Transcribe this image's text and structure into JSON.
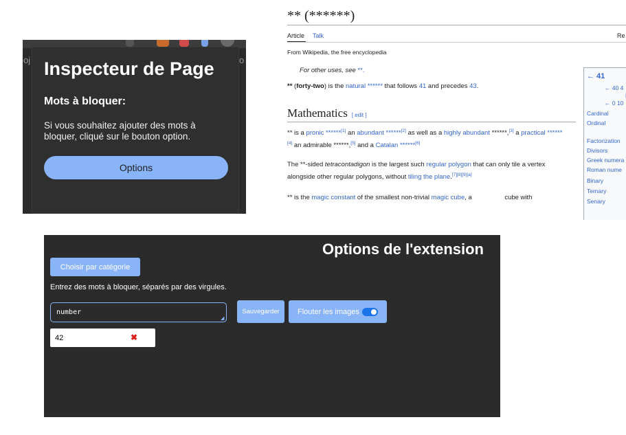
{
  "popup": {
    "side_text_left": "oj",
    "side_text_right": "o",
    "title": "Inspecteur de Page",
    "subtitle": "Mots à bloquer:",
    "info": "Si vous souhaitez ajouter des mots à bloquer, cliqué sur le bouton option.",
    "options_button": "Options",
    "accent_color": "#8ab4f8"
  },
  "wiki": {
    "title": "** (******)",
    "tabs": {
      "article": "Article",
      "talk": "Talk",
      "read": "Re"
    },
    "from": "From Wikipedia, the free encyclopedia",
    "hatnote_prefix": "For other uses, see ",
    "hatnote_link": "**.",
    "intro": {
      "a": "**",
      "b": " (",
      "bold2": "forty-two",
      "c": ") is the ",
      "link1": "natural ******",
      "d": " that follows ",
      "link2": "41",
      "e": " and precedes ",
      "link3": "43",
      "f": "."
    },
    "section_title": "Mathematics",
    "section_edit": "[ edit ]",
    "math_p1": {
      "a": "** is a ",
      "l1": "pronic ******",
      "s1": "[1]",
      "b": " an ",
      "l2": "abundant ******",
      "s2": "[2]",
      "c": " as well as a ",
      "l3": "highly abundant",
      "d": " ******,",
      "s3": "[3]",
      "e": " a ",
      "l4": "practical ******",
      "s4": "[4]",
      "f": " an admirable ******,",
      "s5": "[5]",
      "g": " and a ",
      "l5": "Catalan ******",
      "s6": "[6]"
    },
    "math_p2": {
      "a": "The **-sided ",
      "i": "tetracontadigon",
      "b": " is the largest such ",
      "l1": "regular polygon",
      "c": " that can only tile a vertex alongside other regular polygons, without ",
      "l2": "tiling the plane",
      "d": ".",
      "s": "[7][8][9][a]"
    },
    "math_p3": {
      "a": "** is the ",
      "l1": "magic constant",
      "b": " of the smallest non-trivial ",
      "l2": "magic cube",
      "c": ", a                  cube with"
    },
    "infobox": {
      "prev": "← 41",
      "row1": "← 40 4",
      "row2": "L",
      "row3": "← 0 10",
      "items": [
        "Cardinal",
        "Ordinal",
        "Factorization",
        "Divisors",
        "Greek numera",
        "Roman nume",
        "Binary",
        "Ternary",
        "Senary"
      ]
    },
    "link_color": "#3366cc"
  },
  "options": {
    "title": "Options de l'extension",
    "category_button": "Choisir par catégorie",
    "instructions": "Entrez des mots à bloquer, séparés par des virgules.",
    "input_value": "number",
    "save_button": "Sauvegarder",
    "blur_label": "Flouter les images",
    "blur_enabled": true,
    "blocked_words": [
      "42"
    ],
    "remove_icon": "✖"
  }
}
